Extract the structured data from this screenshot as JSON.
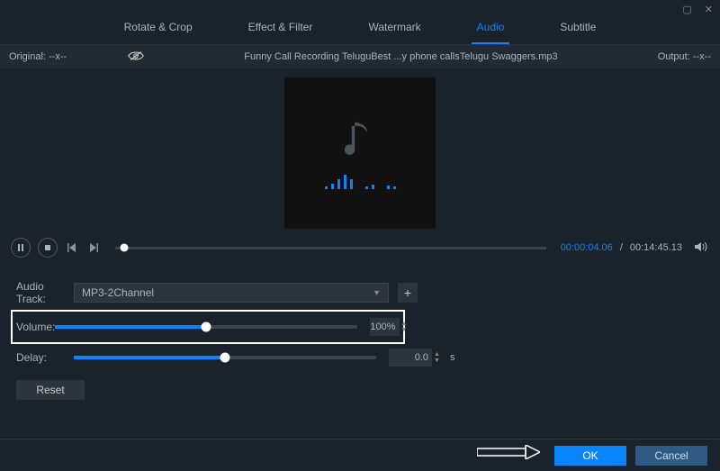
{
  "tabs": {
    "rotate": "Rotate & Crop",
    "effect": "Effect & Filter",
    "watermark": "Watermark",
    "audio": "Audio",
    "subtitle": "Subtitle"
  },
  "infobar": {
    "original_label": "Original: --x--",
    "filename": "Funny Call Recording TeluguBest ...y phone callsTelugu Swaggers.mp3",
    "output_label": "Output: --x--"
  },
  "playbar": {
    "current_time": "00:00:04.06",
    "separator": "/",
    "total_time": "00:14:45.13"
  },
  "controls": {
    "audiotrack_label": "Audio Track:",
    "audiotrack_value": "MP3-2Channel",
    "volume_label": "Volume:",
    "volume_value": "100%",
    "delay_label": "Delay:",
    "delay_value": "0.0",
    "delay_unit": "s",
    "reset_label": "Reset"
  },
  "footer": {
    "ok": "OK",
    "cancel": "Cancel"
  }
}
